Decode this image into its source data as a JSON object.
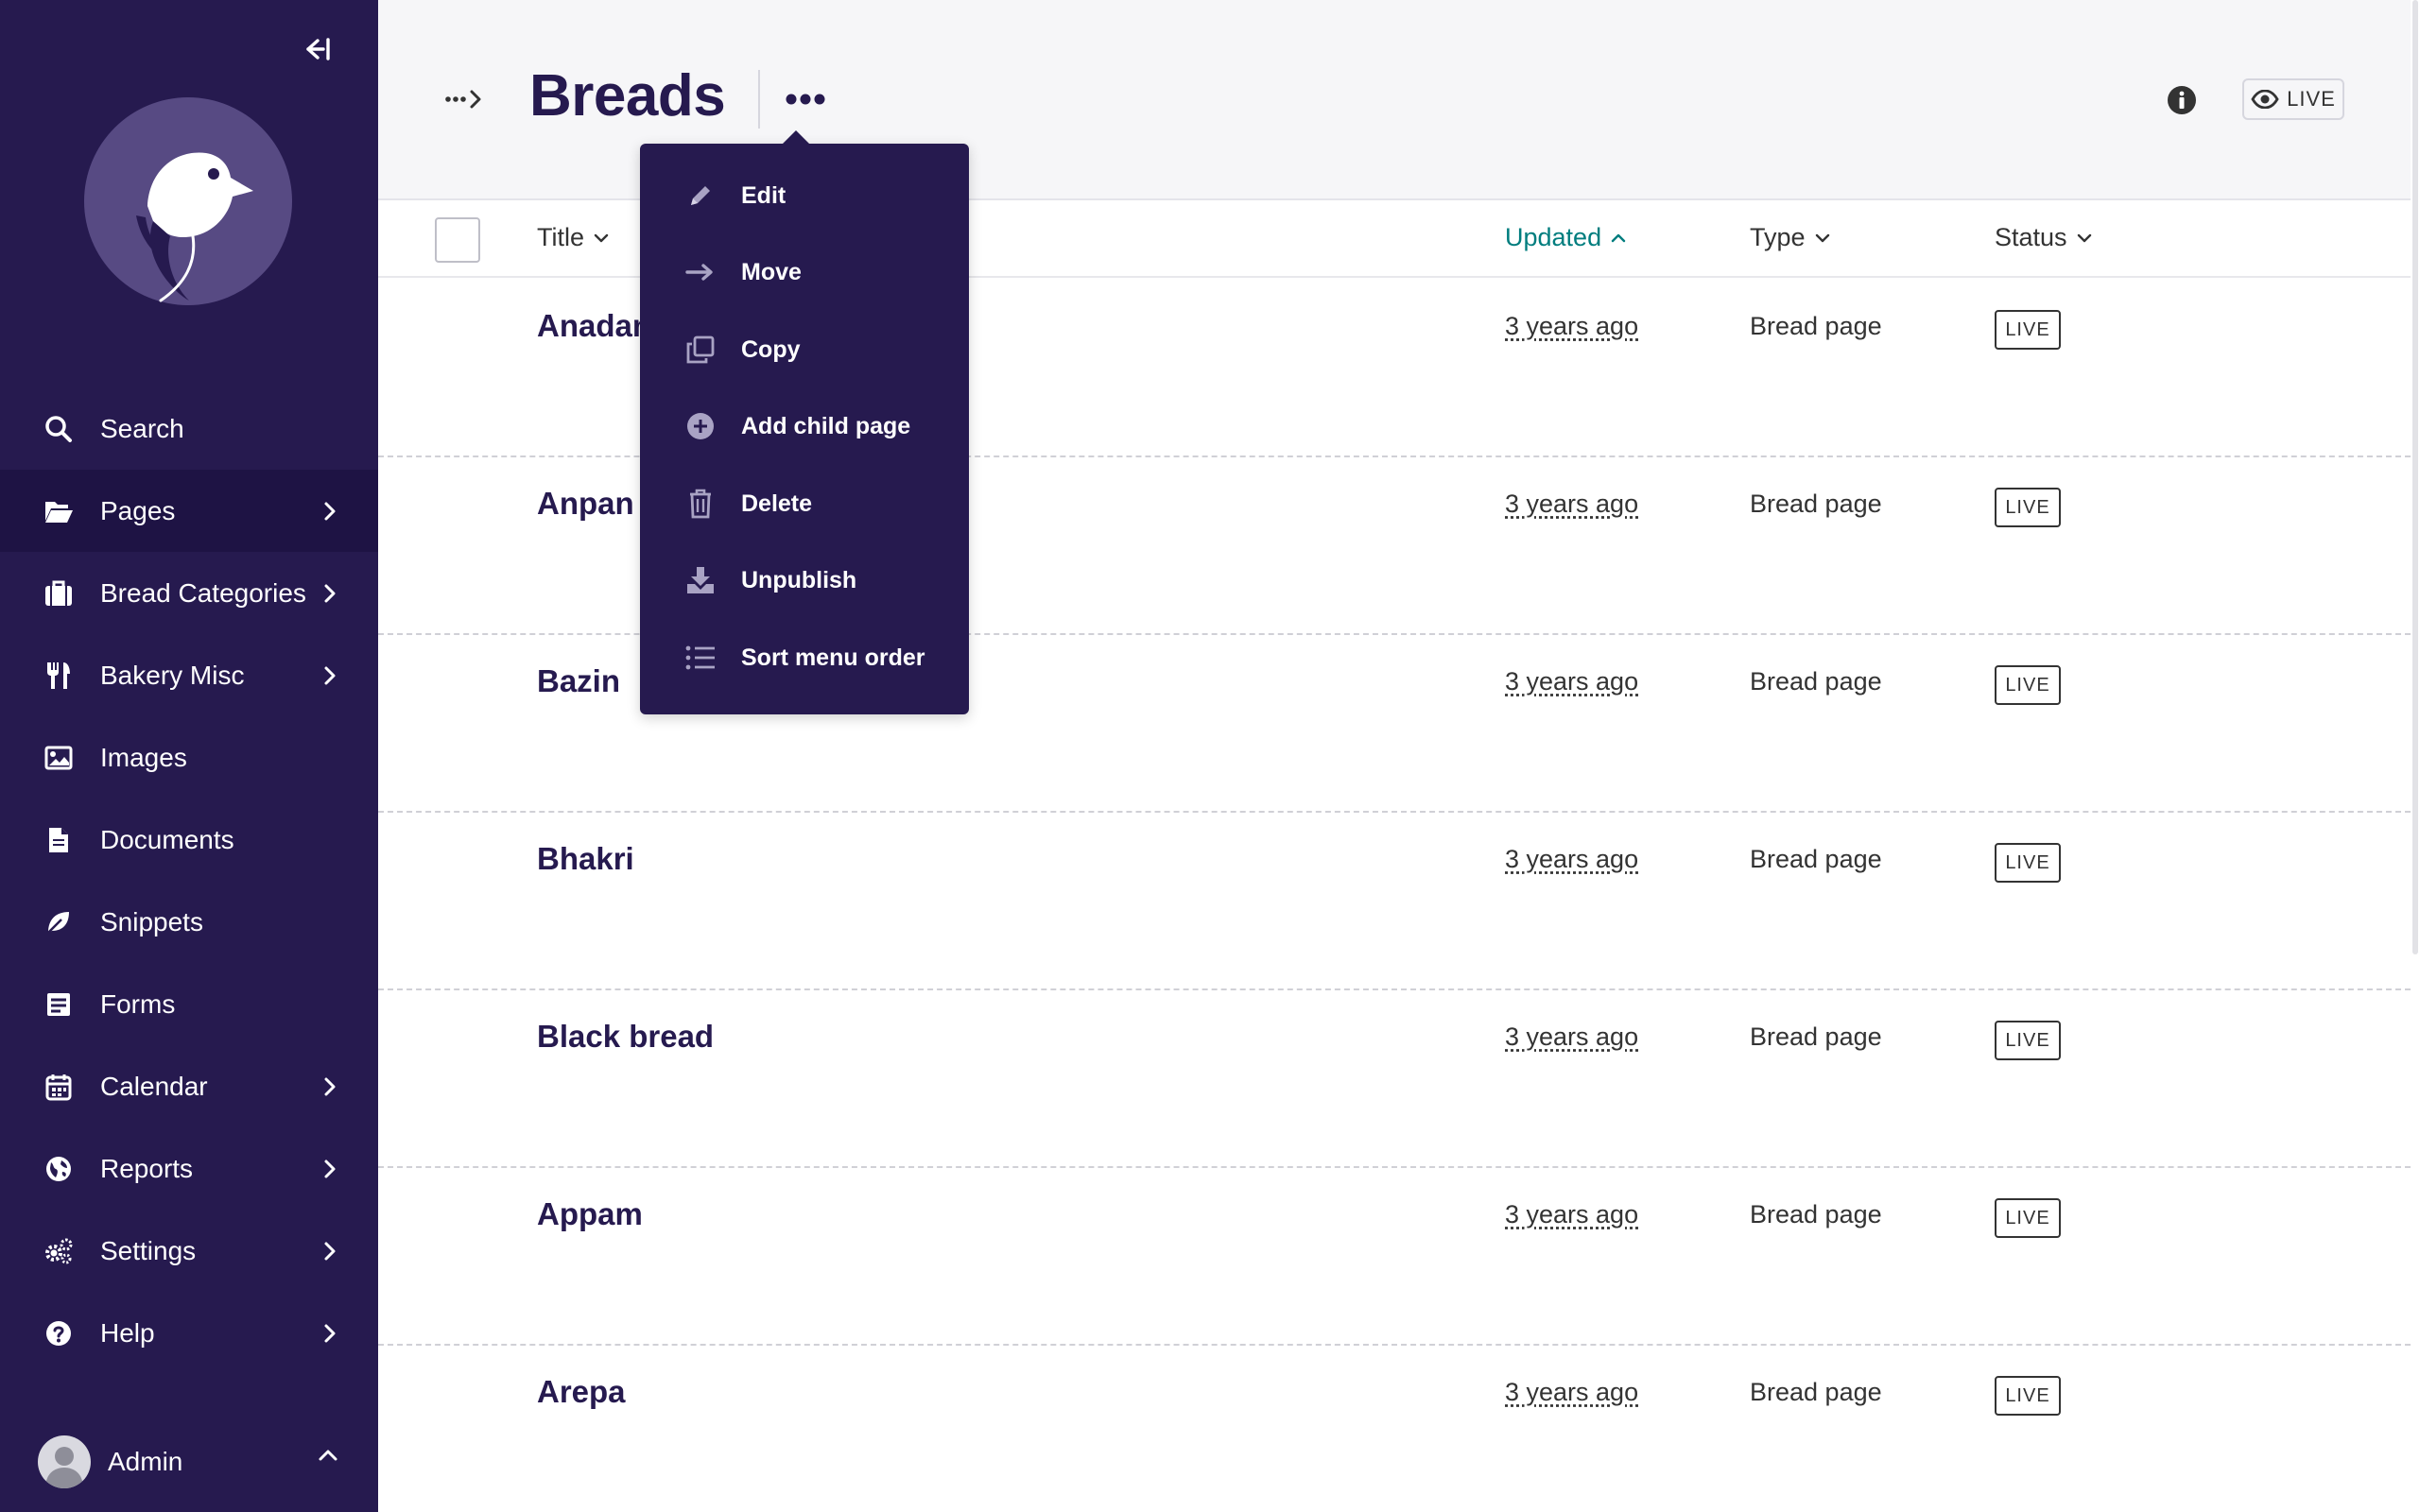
{
  "sidebar": {
    "collapse_label": "Collapse sidebar",
    "items": [
      {
        "label": "Search",
        "icon": "search-icon",
        "has_submenu": false,
        "active": false
      },
      {
        "label": "Pages",
        "icon": "folder-open-icon",
        "has_submenu": true,
        "active": true
      },
      {
        "label": "Bread Categories",
        "icon": "suitcase-icon",
        "has_submenu": true,
        "active": false
      },
      {
        "label": "Bakery Misc",
        "icon": "utensils-icon",
        "has_submenu": true,
        "active": false
      },
      {
        "label": "Images",
        "icon": "image-icon",
        "has_submenu": false,
        "active": false
      },
      {
        "label": "Documents",
        "icon": "document-icon",
        "has_submenu": false,
        "active": false
      },
      {
        "label": "Snippets",
        "icon": "snippet-icon",
        "has_submenu": false,
        "active": false
      },
      {
        "label": "Forms",
        "icon": "form-icon",
        "has_submenu": false,
        "active": false
      },
      {
        "label": "Calendar",
        "icon": "calendar-icon",
        "has_submenu": true,
        "active": false
      },
      {
        "label": "Reports",
        "icon": "globe-icon",
        "has_submenu": true,
        "active": false
      },
      {
        "label": "Settings",
        "icon": "cogs-icon",
        "has_submenu": true,
        "active": false
      },
      {
        "label": "Help",
        "icon": "help-icon",
        "has_submenu": true,
        "active": false
      }
    ],
    "account": {
      "name": "Admin"
    }
  },
  "header": {
    "title": "Breads",
    "live_label": "LIVE"
  },
  "actions_menu": {
    "items": [
      {
        "label": "Edit",
        "icon": "pencil-icon"
      },
      {
        "label": "Move",
        "icon": "arrow-right-icon"
      },
      {
        "label": "Copy",
        "icon": "copy-icon"
      },
      {
        "label": "Add child page",
        "icon": "plus-circle-icon"
      },
      {
        "label": "Delete",
        "icon": "trash-icon"
      },
      {
        "label": "Unpublish",
        "icon": "download-icon"
      },
      {
        "label": "Sort menu order",
        "icon": "list-icon"
      }
    ]
  },
  "table": {
    "columns": {
      "title": "Title",
      "updated": "Updated",
      "type": "Type",
      "status": "Status"
    },
    "sorted_column": "updated",
    "rows": [
      {
        "title": "Anadama bread",
        "updated": "3 years ago",
        "type": "Bread page",
        "status": "LIVE"
      },
      {
        "title": "Anpan",
        "updated": "3 years ago",
        "type": "Bread page",
        "status": "LIVE"
      },
      {
        "title": "Bazin",
        "updated": "3 years ago",
        "type": "Bread page",
        "status": "LIVE"
      },
      {
        "title": "Bhakri",
        "updated": "3 years ago",
        "type": "Bread page",
        "status": "LIVE"
      },
      {
        "title": "Black bread",
        "updated": "3 years ago",
        "type": "Bread page",
        "status": "LIVE"
      },
      {
        "title": "Appam",
        "updated": "3 years ago",
        "type": "Bread page",
        "status": "LIVE"
      },
      {
        "title": "Arepa",
        "updated": "3 years ago",
        "type": "Bread page",
        "status": "LIVE"
      }
    ]
  },
  "colors": {
    "sidebar_bg": "#261a4f",
    "sidebar_active": "#1e1344",
    "header_bg": "#f6f6f8",
    "title": "#261a4f",
    "sorted_column": "#007d7e"
  }
}
